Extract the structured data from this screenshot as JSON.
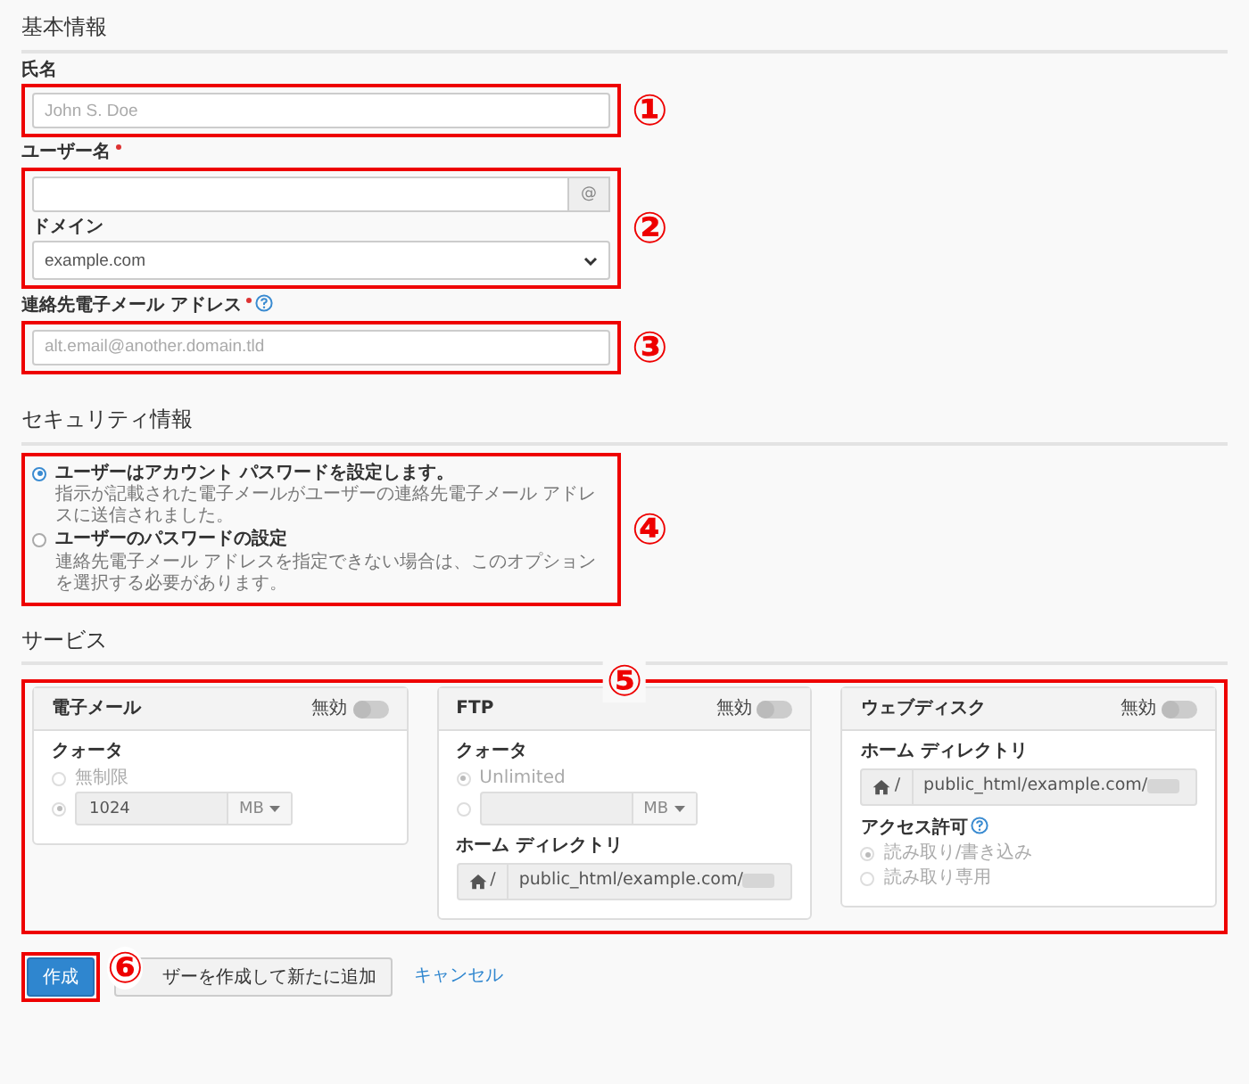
{
  "basic_info": {
    "heading": "基本情報",
    "full_name": {
      "label": "氏名",
      "placeholder": "John S. Doe"
    },
    "username": {
      "label": "ユーザー名",
      "required": true,
      "addon": "@"
    },
    "domain": {
      "label": "ドメイン",
      "value": "example.com"
    },
    "contact_email": {
      "label": "連絡先電子メール アドレス",
      "required": true,
      "help": true,
      "placeholder": "alt.email@another.domain.tld"
    }
  },
  "security": {
    "heading": "セキュリティ情報",
    "options": [
      {
        "label": "ユーザーはアカウント パスワードを設定します。",
        "description": "指示が記載された電子メールがユーザーの連絡先電子メール アドレスに送信されました。",
        "selected": true
      },
      {
        "label": "ユーザーのパスワードの設定",
        "description": "連絡先電子メール アドレスを指定できない場合は、このオプションを選択する必要があります。",
        "selected": false
      }
    ]
  },
  "services": {
    "heading": "サービス",
    "cards": [
      {
        "title": "電子メール",
        "toggle_label": "無効",
        "on": false,
        "sections": [
          {
            "kind": "quota",
            "label": "クォータ",
            "options": [
              {
                "kind": "plain",
                "label": "無制限",
                "selected": false
              },
              {
                "kind": "size",
                "value": "1024",
                "unit": "MB",
                "selected": true
              }
            ]
          }
        ]
      },
      {
        "title": "FTP",
        "toggle_label": "無効",
        "on": false,
        "sections": [
          {
            "kind": "quota",
            "label": "クォータ",
            "options": [
              {
                "kind": "plain",
                "label": "Unlimited",
                "selected": true
              },
              {
                "kind": "size",
                "unit": "MB",
                "selected": false
              }
            ]
          },
          {
            "kind": "path",
            "label": "ホーム ディレクトリ",
            "prefix": "/",
            "value": "public_html/example.com/"
          }
        ]
      },
      {
        "title": "ウェブディスク",
        "toggle_label": "無効",
        "on": false,
        "sections": [
          {
            "kind": "path",
            "label": "ホーム ディレクトリ",
            "prefix": "/",
            "value": "public_html/example.com/"
          },
          {
            "kind": "access",
            "label": "アクセス許可",
            "help": true,
            "options": [
              {
                "kind": "plain",
                "label": "読み取り/書き込み",
                "selected": true
              },
              {
                "kind": "plain",
                "label": "読み取り専用",
                "selected": false
              }
            ]
          }
        ]
      }
    ]
  },
  "actions": {
    "buttons": [
      {
        "label": "作成",
        "kind": "primary"
      },
      {
        "label": "ザーを作成して新たに追加",
        "kind": "secondary"
      },
      {
        "label": "キャンセル",
        "kind": "link"
      }
    ]
  },
  "annotations": [
    {
      "label": "①"
    },
    {
      "label": "②"
    },
    {
      "label": "③"
    },
    {
      "label": "④"
    },
    {
      "label": "⑤"
    },
    {
      "label": "⑥"
    }
  ]
}
